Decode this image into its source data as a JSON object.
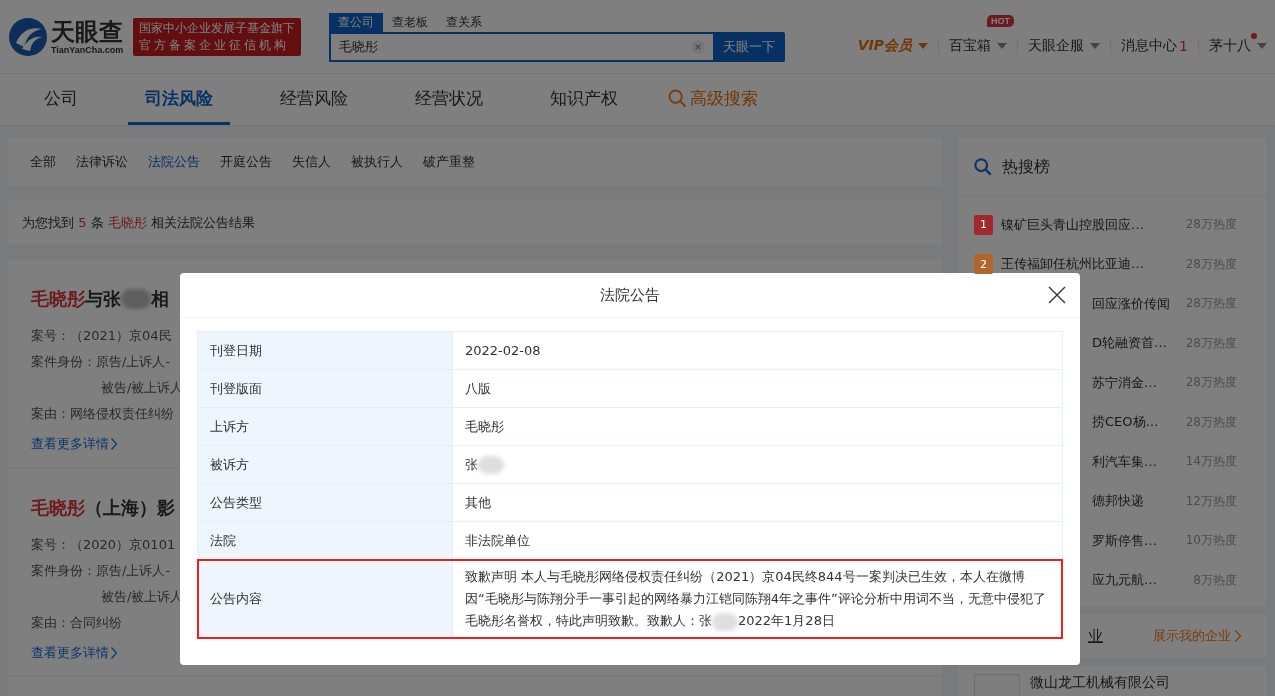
{
  "header": {
    "logo": {
      "name": "天眼查",
      "domain": "TianYanCha.com"
    },
    "banner": [
      "国家中小企业发展子基金旗下",
      "官方备案企业征信机构"
    ],
    "search": {
      "tabs": [
        {
          "label": "查公司",
          "selected": true
        },
        {
          "label": "查老板",
          "selected": false
        },
        {
          "label": "查关系",
          "selected": false
        }
      ],
      "value": "毛晓彤",
      "button": "天眼一下"
    },
    "menu": [
      {
        "kind": "vip",
        "label": "VIP会员"
      },
      {
        "kind": "dropdown",
        "label": "百宝箱",
        "badge": "HOT"
      },
      {
        "kind": "dropdown",
        "label": "天眼企服"
      },
      {
        "kind": "count",
        "label": "消息中心",
        "count": "1"
      },
      {
        "kind": "user",
        "label": "茅十八",
        "dot": true
      }
    ]
  },
  "nav": [
    {
      "label": "公司",
      "selected": false
    },
    {
      "label": "司法风险",
      "selected": true
    },
    {
      "label": "经营风险",
      "selected": false
    },
    {
      "label": "经营状况",
      "selected": false
    },
    {
      "label": "知识产权",
      "selected": false
    },
    {
      "label": "高级搜索",
      "selected": false,
      "kind": "search"
    }
  ],
  "subtabs": [
    {
      "label": "全部",
      "selected": false
    },
    {
      "label": "法律诉讼",
      "selected": false
    },
    {
      "label": "法院公告",
      "selected": true
    },
    {
      "label": "开庭公告",
      "selected": false
    },
    {
      "label": "失信人",
      "selected": false
    },
    {
      "label": "被执行人",
      "selected": false
    },
    {
      "label": "破产重整",
      "selected": false
    }
  ],
  "summary": {
    "prefix": "为您找到",
    "count": "5",
    "unit": "条",
    "keyword": "毛晓彤",
    "suffix": "相关法院公告结果"
  },
  "cases": [
    {
      "keyword": "毛晓彤",
      "rest": "与张",
      "redacted": true,
      "tail": "相",
      "lines": [
        {
          "label": "案号：",
          "value": "（2021）京04民"
        },
        {
          "label": "案件身份：",
          "value": "原告/上诉人-"
        },
        {
          "value": "被告/被上诉人"
        },
        {
          "label": "案由：",
          "value": "网络侵权责任纠纷"
        }
      ],
      "link": "查看更多详情"
    },
    {
      "keyword": "毛晓彤",
      "rest": "（上海）影",
      "redacted": false,
      "lines": [
        {
          "label": "案号：",
          "value": "（2020）京0101"
        },
        {
          "label": "案件身份：",
          "value": "原告/上诉人-"
        },
        {
          "value": "被告/被上诉人"
        },
        {
          "label": "案由：",
          "value": "合同纠纷"
        }
      ],
      "link": "查看更多详情"
    }
  ],
  "hot": {
    "title": "热搜榜",
    "items": [
      {
        "rank": "1",
        "color": "#a3282b",
        "title": "镍矿巨头青山控股回应…",
        "heat": "28万热度"
      },
      {
        "rank": "2",
        "color": "#b0662a",
        "title": "王传福卸任杭州比亚迪…",
        "heat": "28万热度"
      },
      {
        "title": "回应涨价传闻",
        "heat": "28万热度"
      },
      {
        "title": "D轮融资首…",
        "heat": "28万热度"
      },
      {
        "title": "苏宁消金…",
        "heat": "28万热度"
      },
      {
        "title": "捞CEO杨…",
        "heat": "28万热度"
      },
      {
        "title": "利汽车集…",
        "heat": "14万热度"
      },
      {
        "title": "德邦快递",
        "heat": "12万热度"
      },
      {
        "title": "罗斯停售…",
        "heat": "10万热度"
      },
      {
        "title": "应九元航…",
        "heat": "8万热度"
      }
    ]
  },
  "my_company": {
    "heading": "业",
    "link": "展示我的企业",
    "company": "微山龙工机械有限公司"
  },
  "modal": {
    "title": "法院公告",
    "rows": [
      {
        "label": "刊登日期",
        "value": "2022-02-08",
        "highlighted": false
      },
      {
        "label": "刊登版面",
        "value": "八版",
        "highlighted": false
      },
      {
        "label": "上诉方",
        "value": "毛晓彤",
        "highlighted": false
      },
      {
        "label": "被诉方",
        "value": "张",
        "redacted": true,
        "highlighted": false
      },
      {
        "label": "公告类型",
        "value": "其他",
        "highlighted": false
      },
      {
        "label": "法院",
        "value": "非法院单位",
        "highlighted": false
      },
      {
        "label": "公告内容",
        "value": "致歉声明 本人与毛晓彤网络侵权责任纠纷（2021）京04民终844号一案判决已生效，本人在微博因“毛晓彤与陈翔分手一事引起的网络暴力江铠同陈翔4年之事件”评论分析中用词不当，无意中侵犯了毛晓彤名誉权，特此声明致歉。致歉人：张",
        "redacted": true,
        "tail": "2022年1月28日",
        "highlighted": true
      }
    ]
  }
}
